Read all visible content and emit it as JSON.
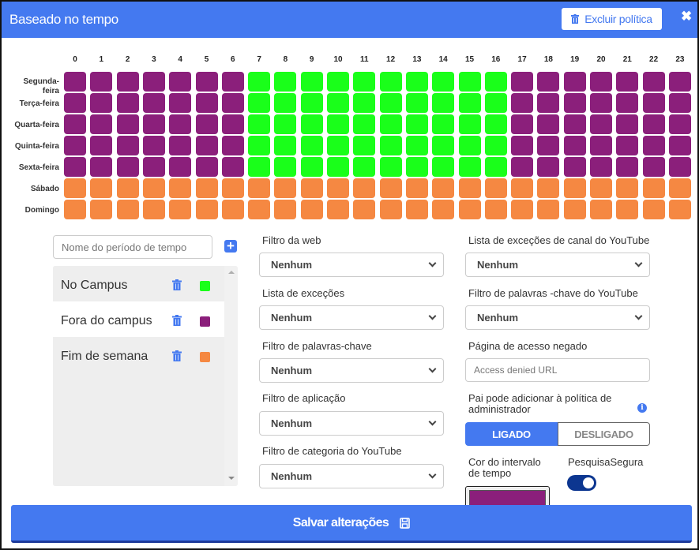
{
  "header": {
    "title": "Baseado no tempo",
    "delete_label": "Excluir política",
    "close_label": "✖"
  },
  "schedule": {
    "hours": [
      "0",
      "1",
      "2",
      "3",
      "4",
      "5",
      "6",
      "7",
      "8",
      "9",
      "10",
      "11",
      "12",
      "13",
      "14",
      "15",
      "16",
      "17",
      "18",
      "19",
      "20",
      "21",
      "22",
      "23"
    ],
    "days": [
      "Segunda-feira",
      "Terça-feira",
      "Quarta-feira",
      "Quinta-feira",
      "Sexta-feira",
      "Sábado",
      "Domingo"
    ],
    "day_labels_display": [
      "Segunda-\nfeira",
      "Terça-feira",
      "Quarta-feira",
      "Quinta-feira",
      "Sexta-feira",
      "Sábado",
      "Domingo"
    ],
    "assignments": [
      [
        "off",
        "off",
        "off",
        "off",
        "off",
        "off",
        "off",
        "on",
        "on",
        "on",
        "on",
        "on",
        "on",
        "on",
        "on",
        "on",
        "on",
        "off",
        "off",
        "off",
        "off",
        "off",
        "off",
        "off"
      ],
      [
        "off",
        "off",
        "off",
        "off",
        "off",
        "off",
        "off",
        "on",
        "on",
        "on",
        "on",
        "on",
        "on",
        "on",
        "on",
        "on",
        "on",
        "off",
        "off",
        "off",
        "off",
        "off",
        "off",
        "off"
      ],
      [
        "off",
        "off",
        "off",
        "off",
        "off",
        "off",
        "off",
        "on",
        "on",
        "on",
        "on",
        "on",
        "on",
        "on",
        "on",
        "on",
        "on",
        "off",
        "off",
        "off",
        "off",
        "off",
        "off",
        "off"
      ],
      [
        "off",
        "off",
        "off",
        "off",
        "off",
        "off",
        "off",
        "on",
        "on",
        "on",
        "on",
        "on",
        "on",
        "on",
        "on",
        "on",
        "on",
        "off",
        "off",
        "off",
        "off",
        "off",
        "off",
        "off"
      ],
      [
        "off",
        "off",
        "off",
        "off",
        "off",
        "off",
        "off",
        "on",
        "on",
        "on",
        "on",
        "on",
        "on",
        "on",
        "on",
        "on",
        "on",
        "off",
        "off",
        "off",
        "off",
        "off",
        "off",
        "off"
      ],
      [
        "wk",
        "wk",
        "wk",
        "wk",
        "wk",
        "wk",
        "wk",
        "wk",
        "wk",
        "wk",
        "wk",
        "wk",
        "wk",
        "wk",
        "wk",
        "wk",
        "wk",
        "wk",
        "wk",
        "wk",
        "wk",
        "wk",
        "wk",
        "wk"
      ],
      [
        "wk",
        "wk",
        "wk",
        "wk",
        "wk",
        "wk",
        "wk",
        "wk",
        "wk",
        "wk",
        "wk",
        "wk",
        "wk",
        "wk",
        "wk",
        "wk",
        "wk",
        "wk",
        "wk",
        "wk",
        "wk",
        "wk",
        "wk",
        "wk"
      ]
    ],
    "colors": {
      "on": "#1aff1a",
      "off": "#8b1f7b",
      "wk": "#f58842"
    }
  },
  "periods": {
    "name_placeholder": "Nome do período de tempo",
    "add_icon": "plus-square-icon",
    "items": [
      {
        "name": "No Campus",
        "color": "#1aff1a",
        "bg": "#eeeeee"
      },
      {
        "name": "Fora do campus",
        "color": "#8b1f7b",
        "bg": "#ffffff"
      },
      {
        "name": "Fim de semana",
        "color": "#f58842",
        "bg": "#eeeeee"
      }
    ]
  },
  "filters": {
    "web_filter": {
      "label": "Filtro da web",
      "value": "Nenhum"
    },
    "exception_list": {
      "label": "Lista de exceções",
      "value": "Nenhum"
    },
    "keyword_filter": {
      "label": "Filtro de palavras-chave",
      "value": "Nenhum"
    },
    "app_filter": {
      "label": "Filtro de aplicação",
      "value": "Nenhum"
    },
    "yt_category_filter": {
      "label": "Filtro de categoria do YouTube",
      "value": "Nenhum"
    },
    "yt_channel_exceptions": {
      "label": "Lista de exceções de canal do YouTube",
      "value": "Nenhum"
    },
    "yt_keyword_filter": {
      "label": "Filtro de palavras -chave do YouTube",
      "value": "Nenhum"
    },
    "access_denied": {
      "label": "Página de acesso negado",
      "placeholder": "Access denied URL",
      "value": ""
    }
  },
  "parent_policy": {
    "label_line1": "Pai pode adicionar à política de",
    "label_line2": "administrador",
    "on_label": "LIGADO",
    "off_label": "DESLIGADO",
    "selected": "LIGADO"
  },
  "interval_color": {
    "label_line1": "Cor do intervalo",
    "label_line2": "de tempo",
    "value": "#8b1f7b"
  },
  "safe_search": {
    "label": "PesquisaSegura",
    "enabled": true
  },
  "footer": {
    "save_label": "Salvar alterações"
  }
}
